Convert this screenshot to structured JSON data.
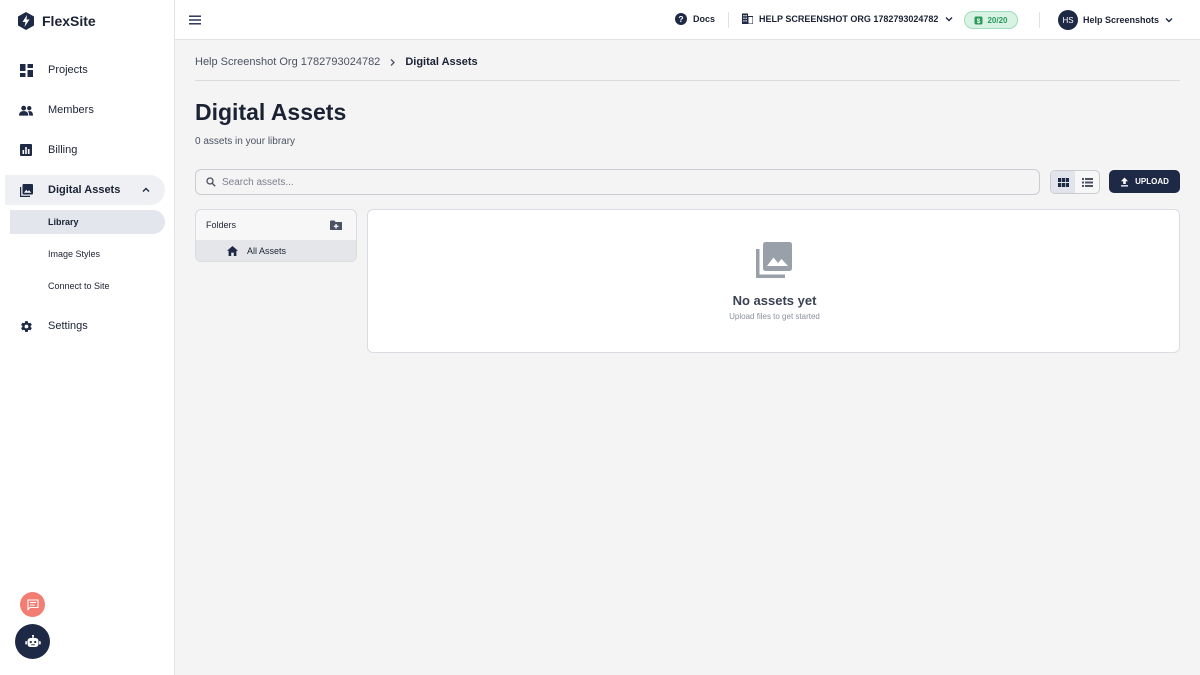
{
  "app": {
    "name": "FlexSite"
  },
  "sidebar": {
    "items": [
      {
        "label": "Projects",
        "icon": "dashboard-icon"
      },
      {
        "label": "Members",
        "icon": "people-icon"
      },
      {
        "label": "Billing",
        "icon": "chart-icon"
      },
      {
        "label": "Digital Assets",
        "icon": "photo-library-icon",
        "expanded": true
      },
      {
        "label": "Settings",
        "icon": "gear-icon"
      }
    ],
    "subitems": [
      {
        "label": "Library",
        "selected": true
      },
      {
        "label": "Image Styles"
      },
      {
        "label": "Connect to Site"
      }
    ]
  },
  "topbar": {
    "docs_label": "Docs",
    "org_label": "HELP SCREENSHOT ORG 1782793024782",
    "credits_label": "20/20",
    "user_initials": "HS",
    "user_name": "Help Screenshots"
  },
  "breadcrumb": {
    "parent": "Help Screenshot Org 1782793024782",
    "current": "Digital Assets"
  },
  "page": {
    "title": "Digital Assets",
    "subtitle": "0 assets in your library"
  },
  "search": {
    "placeholder": "Search assets..."
  },
  "toolbar": {
    "upload_label": "UPLOAD",
    "view_mode": "grid"
  },
  "folders": {
    "header": "Folders",
    "items": [
      {
        "label": "All Assets"
      }
    ]
  },
  "empty_state": {
    "title": "No assets yet",
    "subtitle": "Upload files to get started"
  },
  "colors": {
    "brand_dark": "#1e2a45",
    "accent_green": "#2a9a5c",
    "feedback_red": "#f27d72"
  }
}
